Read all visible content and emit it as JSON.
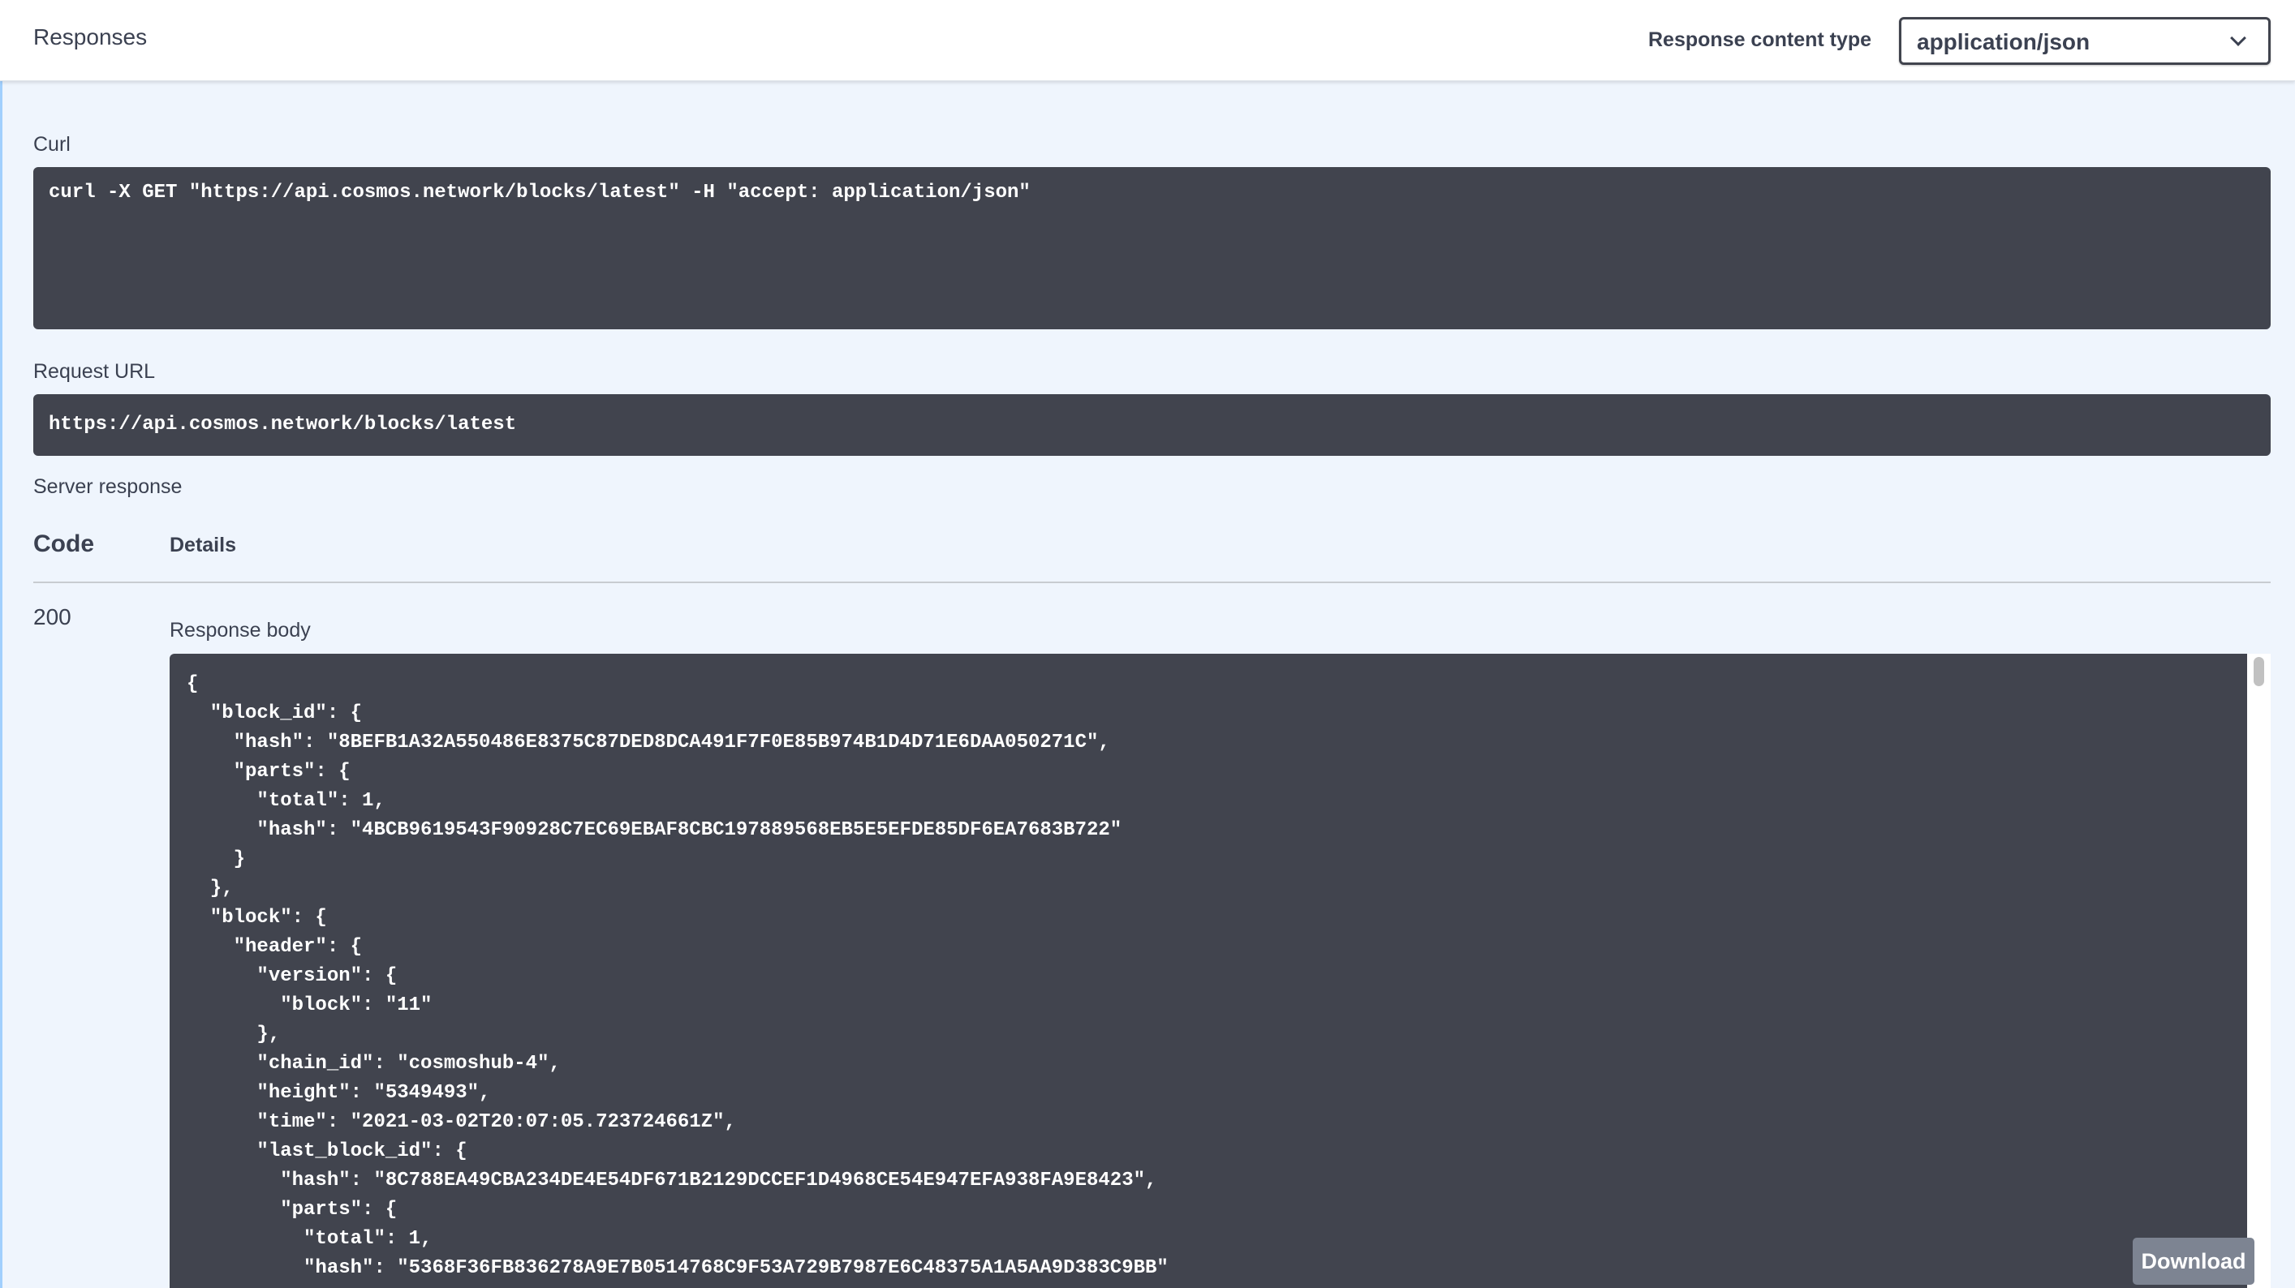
{
  "header": {
    "title": "Responses",
    "content_type_label": "Response content type",
    "content_type_value": "application/json"
  },
  "curl": {
    "label": "Curl",
    "command": "curl -X GET \"https://api.cosmos.network/blocks/latest\" -H \"accept: application/json\""
  },
  "request_url": {
    "label": "Request URL",
    "url": "https://api.cosmos.network/blocks/latest"
  },
  "server_response": {
    "label": "Server response",
    "col_code": "Code",
    "col_details": "Details",
    "status_code": "200",
    "body_label": "Response body",
    "body_lines": [
      "{",
      "  \"block_id\": {",
      "    \"hash\": \"8BEFB1A32A550486E8375C87DED8DCA491F7F0E85B974B1D4D71E6DAA050271C\",",
      "    \"parts\": {",
      "      \"total\": 1,",
      "      \"hash\": \"4BCB9619543F90928C7EC69EBAF8CBC197889568EB5E5EFDE85DF6EA7683B722\"",
      "    }",
      "  },",
      "  \"block\": {",
      "    \"header\": {",
      "      \"version\": {",
      "        \"block\": \"11\"",
      "      },",
      "      \"chain_id\": \"cosmoshub-4\",",
      "      \"height\": \"5349493\",",
      "      \"time\": \"2021-03-02T20:07:05.723724661Z\",",
      "      \"last_block_id\": {",
      "        \"hash\": \"8C788EA49CBA234DE4E54DF671B2129DCCEF1D4968CE54E947EFA938FA9E8423\",",
      "        \"parts\": {",
      "          \"total\": 1,",
      "          \"hash\": \"5368F36FB836278A9E7B0514768C9F53A729B7987E6C48375A1A5AA9D383C9BB\""
    ],
    "download_label": "Download"
  }
}
